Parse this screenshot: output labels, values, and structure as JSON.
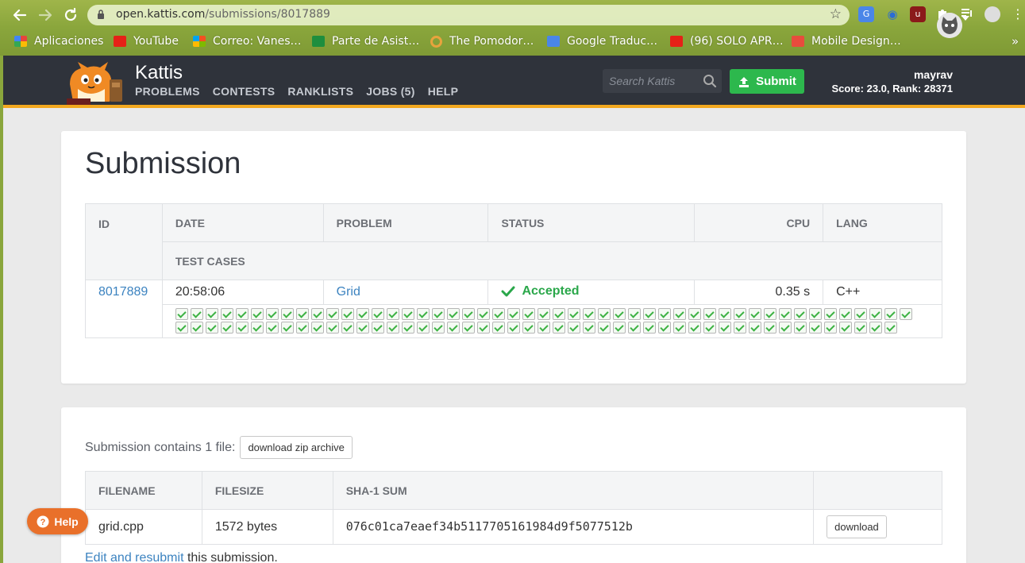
{
  "browser": {
    "url_host": "open.kattis.com",
    "url_path": "/submissions/8017889",
    "bookmarks": [
      {
        "label": "Aplicaciones",
        "icon": "apps-grid-icon",
        "color": "#e8453c"
      },
      {
        "label": "YouTube",
        "icon": "youtube-icon",
        "color": "#e62117"
      },
      {
        "label": "Correo: Vanes…",
        "icon": "outlook-icon",
        "color": "#0078d4"
      },
      {
        "label": "Parte de Asist…",
        "icon": "sheets-plus-icon",
        "color": "#1e8e3e"
      },
      {
        "label": "The Pomodor…",
        "icon": "pomodoro-ring-icon",
        "color": "#e8a33d"
      },
      {
        "label": "Google Traduc…",
        "icon": "google-translate-icon",
        "color": "#4a86e8"
      },
      {
        "label": "(96) SOLO APR…",
        "icon": "youtube-icon",
        "color": "#e62117"
      },
      {
        "label": "Mobile Design…",
        "icon": "p-logo-icon",
        "color": "#e84c3d"
      }
    ]
  },
  "header": {
    "brand": "Kattis",
    "nav": [
      "PROBLEMS",
      "CONTESTS",
      "RANKLISTS",
      "JOBS (5)",
      "HELP"
    ],
    "search_placeholder": "Search Kattis",
    "submit_label": "Submit",
    "username": "mayrav",
    "score_line": "Score: 23.0, Rank: 28371"
  },
  "submission": {
    "title": "Submission",
    "columns": {
      "id": "ID",
      "date": "DATE",
      "problem": "PROBLEM",
      "status": "STATUS",
      "cpu": "CPU",
      "lang": "LANG",
      "test_cases": "TEST CASES"
    },
    "row": {
      "id": "8017889",
      "date": "20:58:06",
      "problem": "Grid",
      "status": "Accepted",
      "cpu": "0.35 s",
      "lang": "C++"
    },
    "test_case_count": 97,
    "test_case_status": "accepted"
  },
  "files": {
    "intro": "Submission contains 1 file:",
    "zip_button": "download zip archive",
    "columns": {
      "filename": "FILENAME",
      "filesize": "FILESIZE",
      "sha1": "SHA-1 SUM"
    },
    "rows": [
      {
        "filename": "grid.cpp",
        "filesize": "1572 bytes",
        "sha1": "076c01ca7eaef34b5117705161984d9f5077512b",
        "download_label": "download"
      }
    ],
    "resubmit_link": "Edit and resubmit",
    "resubmit_rest": " this submission."
  },
  "help_widget": {
    "label": "Help"
  },
  "colors": {
    "accent_orange": "#f3a81f",
    "accepted_green": "#2aa74a",
    "link_blue": "#3c83c0",
    "header_dark": "#2f333b"
  }
}
